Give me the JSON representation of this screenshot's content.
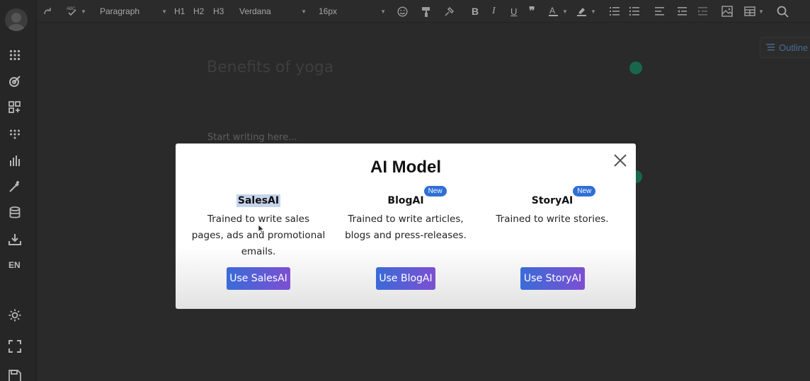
{
  "toolbar": {
    "block_format": "Paragraph",
    "h1": "H1",
    "h2": "H2",
    "h3": "H3",
    "font_family": "Verdana",
    "font_size": "16px"
  },
  "editor": {
    "title": "Benefits of yoga",
    "placeholder": "Start writing here..."
  },
  "outline_label": "Outline",
  "sidebar": {
    "language": "EN"
  },
  "modal": {
    "title": "AI Model",
    "models": [
      {
        "name": "SalesAI",
        "badge": "",
        "description_lines": [
          "Trained to write sales",
          "pages, ads and promotional",
          "emails."
        ],
        "button": "Use SalesAI"
      },
      {
        "name": "BlogAI",
        "badge": "New",
        "description_lines": [
          "Trained to write articles,",
          "blogs and press-releases."
        ],
        "button": "Use BlogAI"
      },
      {
        "name": "StoryAI",
        "badge": "New",
        "description_lines": [
          "Trained to write stories."
        ],
        "button": "Use StoryAI"
      }
    ]
  },
  "colors": {
    "overlay_bg": "#2a2a2a",
    "badge_blue": "#2f6fd6",
    "button_gradient_start": "#3a6bd8",
    "button_gradient_end": "#7d4fd2",
    "selection": "#c5d4ec",
    "grammarly_green": "#11825c"
  }
}
